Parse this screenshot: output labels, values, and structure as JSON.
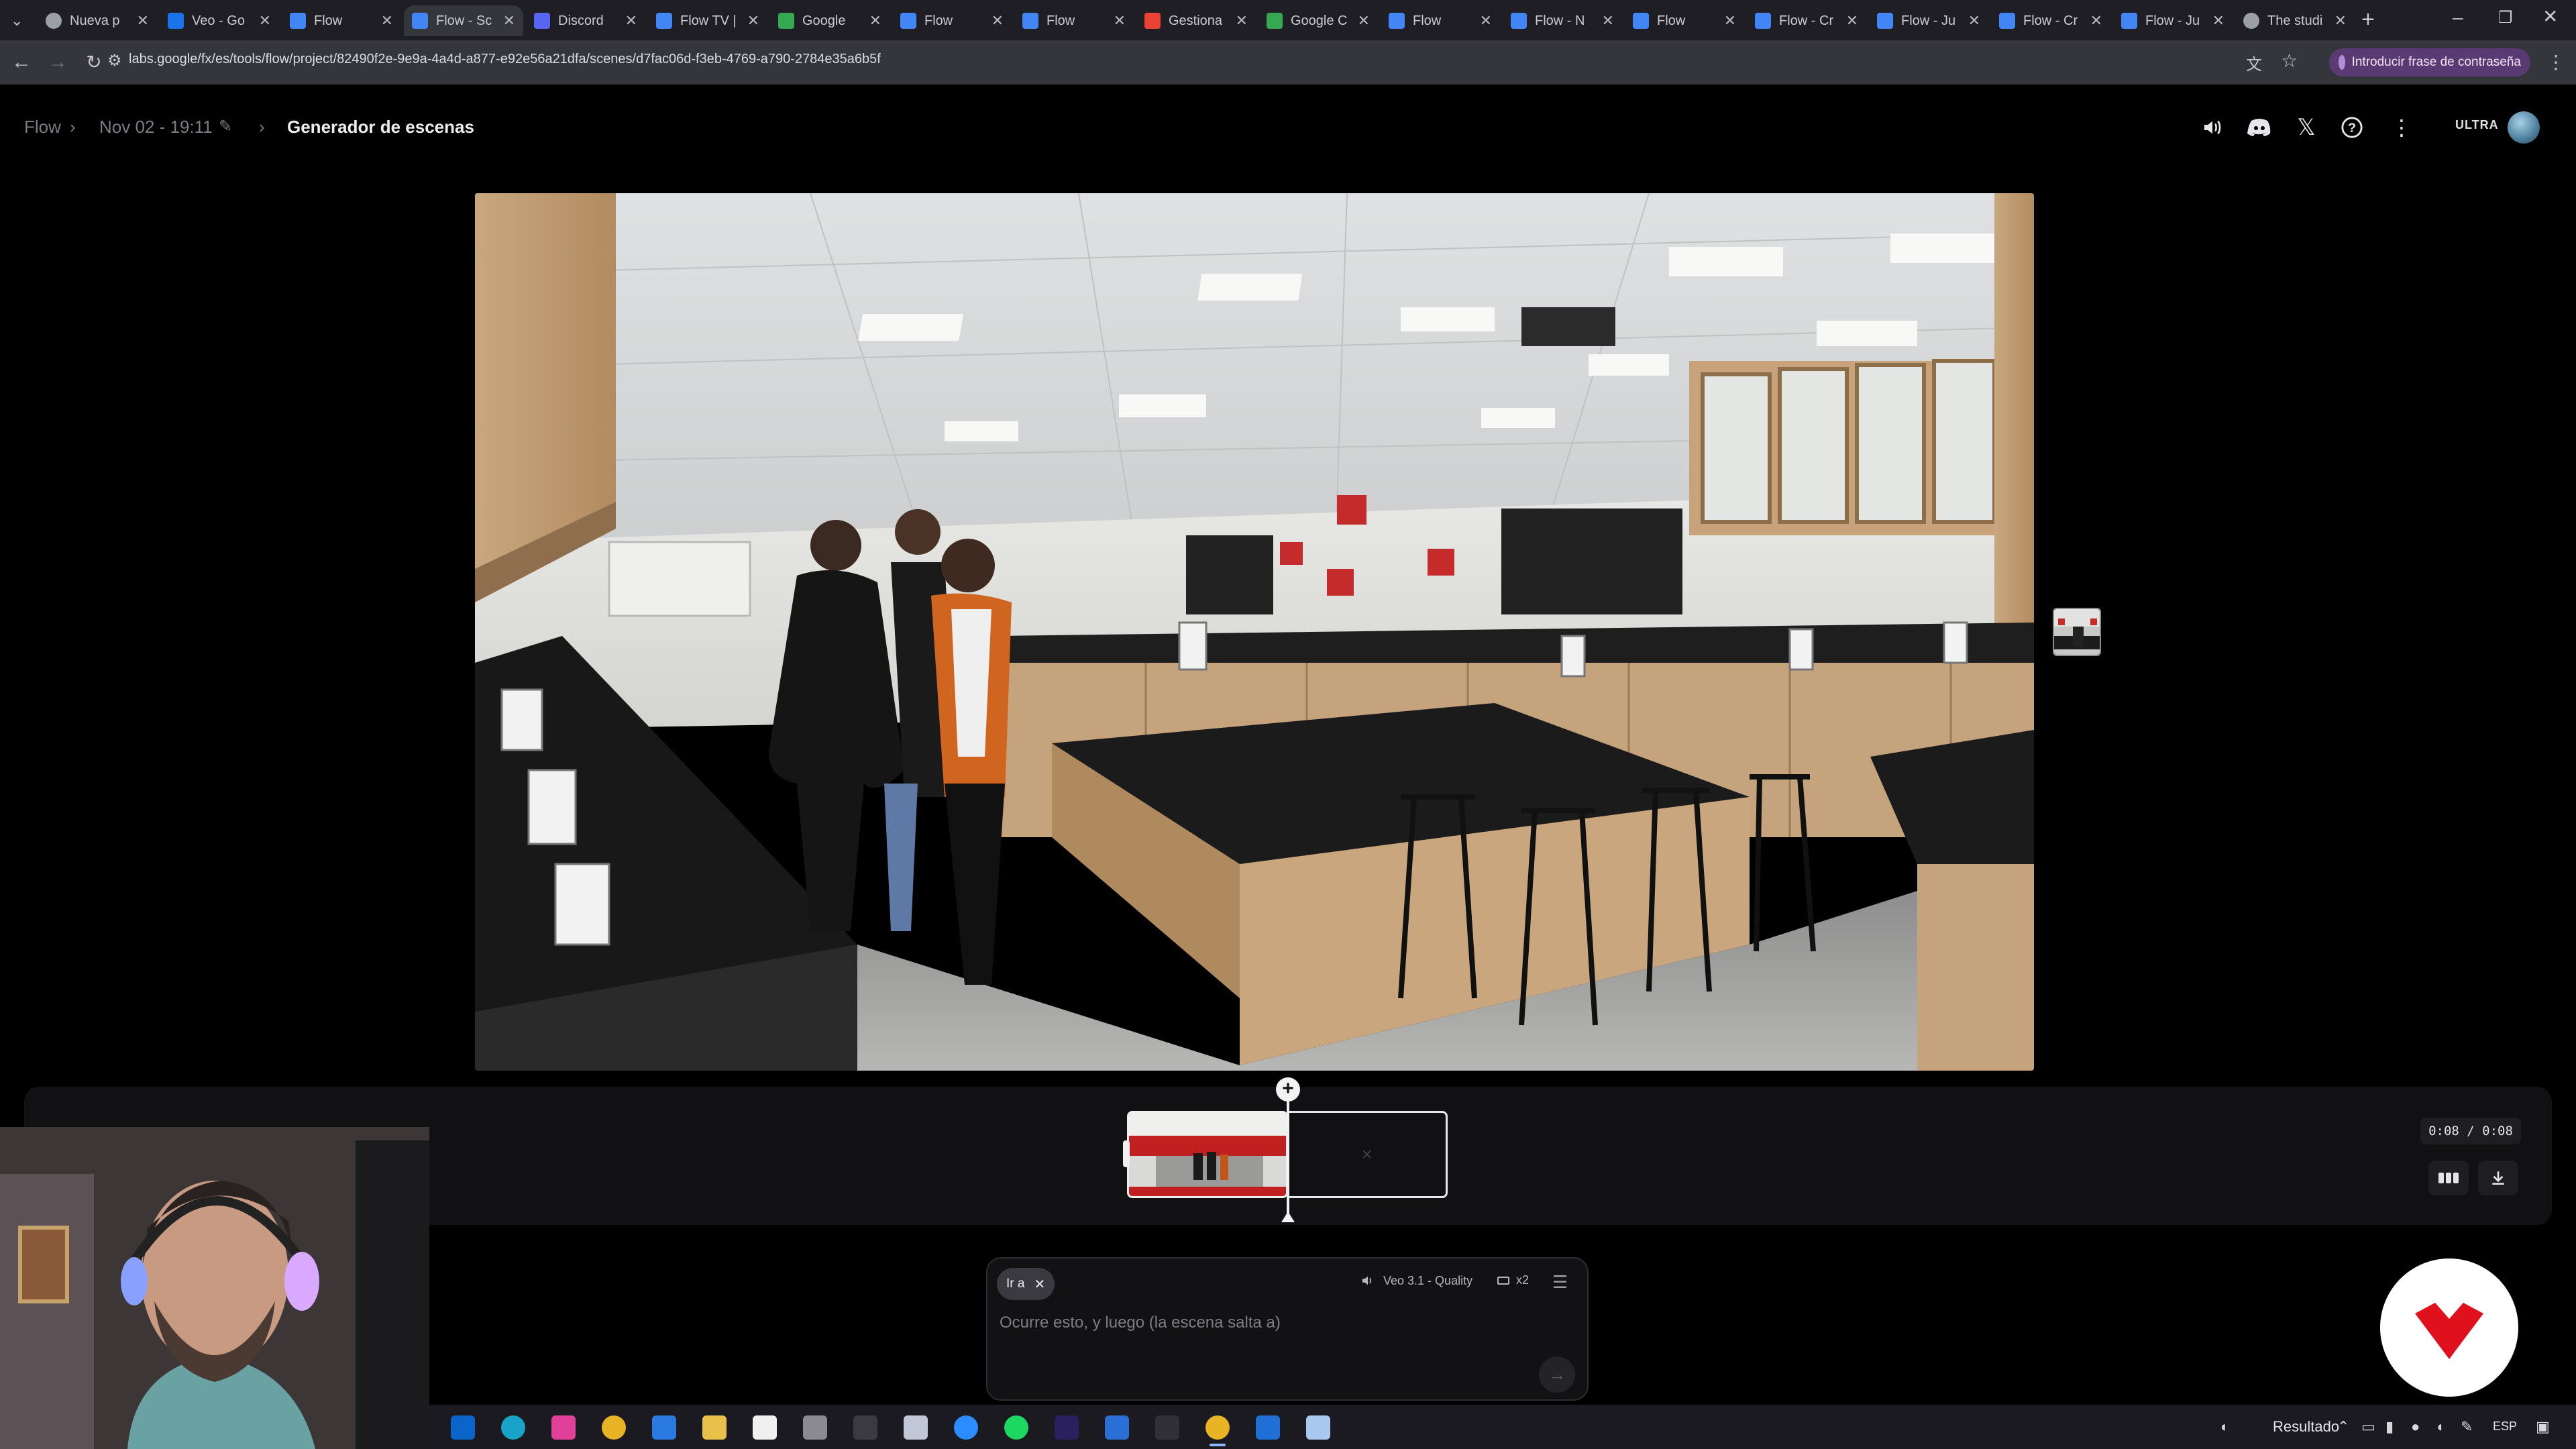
{
  "browser": {
    "tabs": [
      {
        "title": "Nueva p",
        "active": false
      },
      {
        "title": "Veo - Go",
        "active": false
      },
      {
        "title": "Flow",
        "active": false
      },
      {
        "title": "Flow - Sc",
        "active": true
      },
      {
        "title": "Discord",
        "active": false
      },
      {
        "title": "Flow TV |",
        "active": false
      },
      {
        "title": "Google",
        "active": false
      },
      {
        "title": "Flow",
        "active": false
      },
      {
        "title": "Flow",
        "active": false
      },
      {
        "title": "Gestiona",
        "active": false
      },
      {
        "title": "Google C",
        "active": false
      },
      {
        "title": "Flow",
        "active": false
      },
      {
        "title": "Flow - N",
        "active": false
      },
      {
        "title": "Flow",
        "active": false
      },
      {
        "title": "Flow - Cr",
        "active": false
      },
      {
        "title": "Flow - Ju",
        "active": false
      },
      {
        "title": "Flow - Cr",
        "active": false
      },
      {
        "title": "Flow - Ju",
        "active": false
      },
      {
        "title": "The studi",
        "active": false
      }
    ],
    "url": "labs.google/fx/es/tools/flow/project/82490f2e-9e9a-4a4d-a877-e92e56a21dfa/scenes/d7fac06d-f3eb-4769-a790-2784e35a6b5f",
    "password_chip": "Introducir frase de contraseña"
  },
  "header": {
    "crumb_root": "Flow",
    "crumb_project": "Nov 02 - 19:11",
    "crumb_title": "Generador de escenas",
    "plan_badge": "ULTRA"
  },
  "timeline": {
    "time_readout": "0:08 / 0:08",
    "empty_clip_glyph": "×"
  },
  "prompt": {
    "chip_label": "Ir a",
    "model": "Veo 3.1 - Quality",
    "count": "x2",
    "placeholder": "Ocurre esto, y luego (la escena salta a)"
  },
  "taskbar": {
    "result_label": "Resultado",
    "lang": "ESP"
  },
  "colors": {
    "background": "#000000",
    "accent_purple": "#5a3a72",
    "logo_red": "#e0101c"
  }
}
